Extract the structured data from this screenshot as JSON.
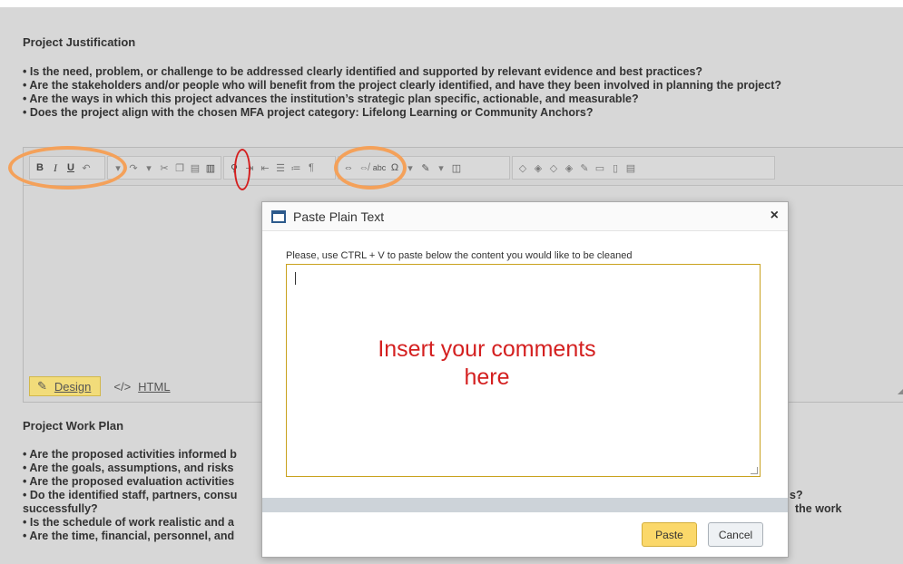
{
  "justification": {
    "title": "Project Justification",
    "bullets": [
      "• Is the need, problem, or challenge to be addressed clearly identified and supported by relevant evidence and best practices?",
      "• Are the stakeholders and/or people who will benefit from the project clearly identified, and have they been involved in planning the project?",
      "• Are the ways in which this project advances the institution’s strategic plan specific, actionable, and measurable?",
      "• Does the project align with the chosen MFA project category: Lifelong Learning or Community Anchors?"
    ]
  },
  "toolbar": {
    "icons": [
      "bold",
      "italic",
      "underline",
      "undo",
      "redo",
      "cut",
      "copy",
      "paste",
      "paste-plain-text",
      "find",
      "indent",
      "outdent",
      "ordered-list",
      "bullet-list",
      "paragraph",
      "link",
      "unlink",
      "spellcheck",
      "symbol",
      "format-painter",
      "html-snippet",
      "track-changes",
      "accept",
      "reject",
      "accept-all",
      "reject-all",
      "comment",
      "delete-comment",
      "comments-list"
    ],
    "bold": "B",
    "italic": "I",
    "underline": "U"
  },
  "editor_modes": {
    "design": "Design",
    "html": "HTML",
    "html_icon": "</>"
  },
  "work_plan": {
    "title": "Project Work Plan",
    "bullets_left": [
      "• Are the proposed activities informed b",
      "• Are the goals, assumptions, and risks",
      "• Are the proposed evaluation activities",
      "• Do the identified staff, partners, consu",
      "successfully?",
      "• Is the schedule of work realistic and a",
      "• Are the time, financial, personnel, and"
    ],
    "bullets_right": [
      "s?",
      "the work"
    ]
  },
  "dialog": {
    "title": "Paste Plain Text",
    "close": "×",
    "instruction": "Please, use CTRL + V to paste below the content you would like to be cleaned",
    "textarea_value": "",
    "overlay_note_line1": "Insert your comments",
    "overlay_note_line2": "here",
    "paste_button": "Paste",
    "cancel_button": "Cancel"
  },
  "colors": {
    "annotation_orange": "#f4a15a",
    "annotation_red": "#d41f1f",
    "accent_yellow": "#fbd86a",
    "textarea_border": "#c9a21e"
  }
}
